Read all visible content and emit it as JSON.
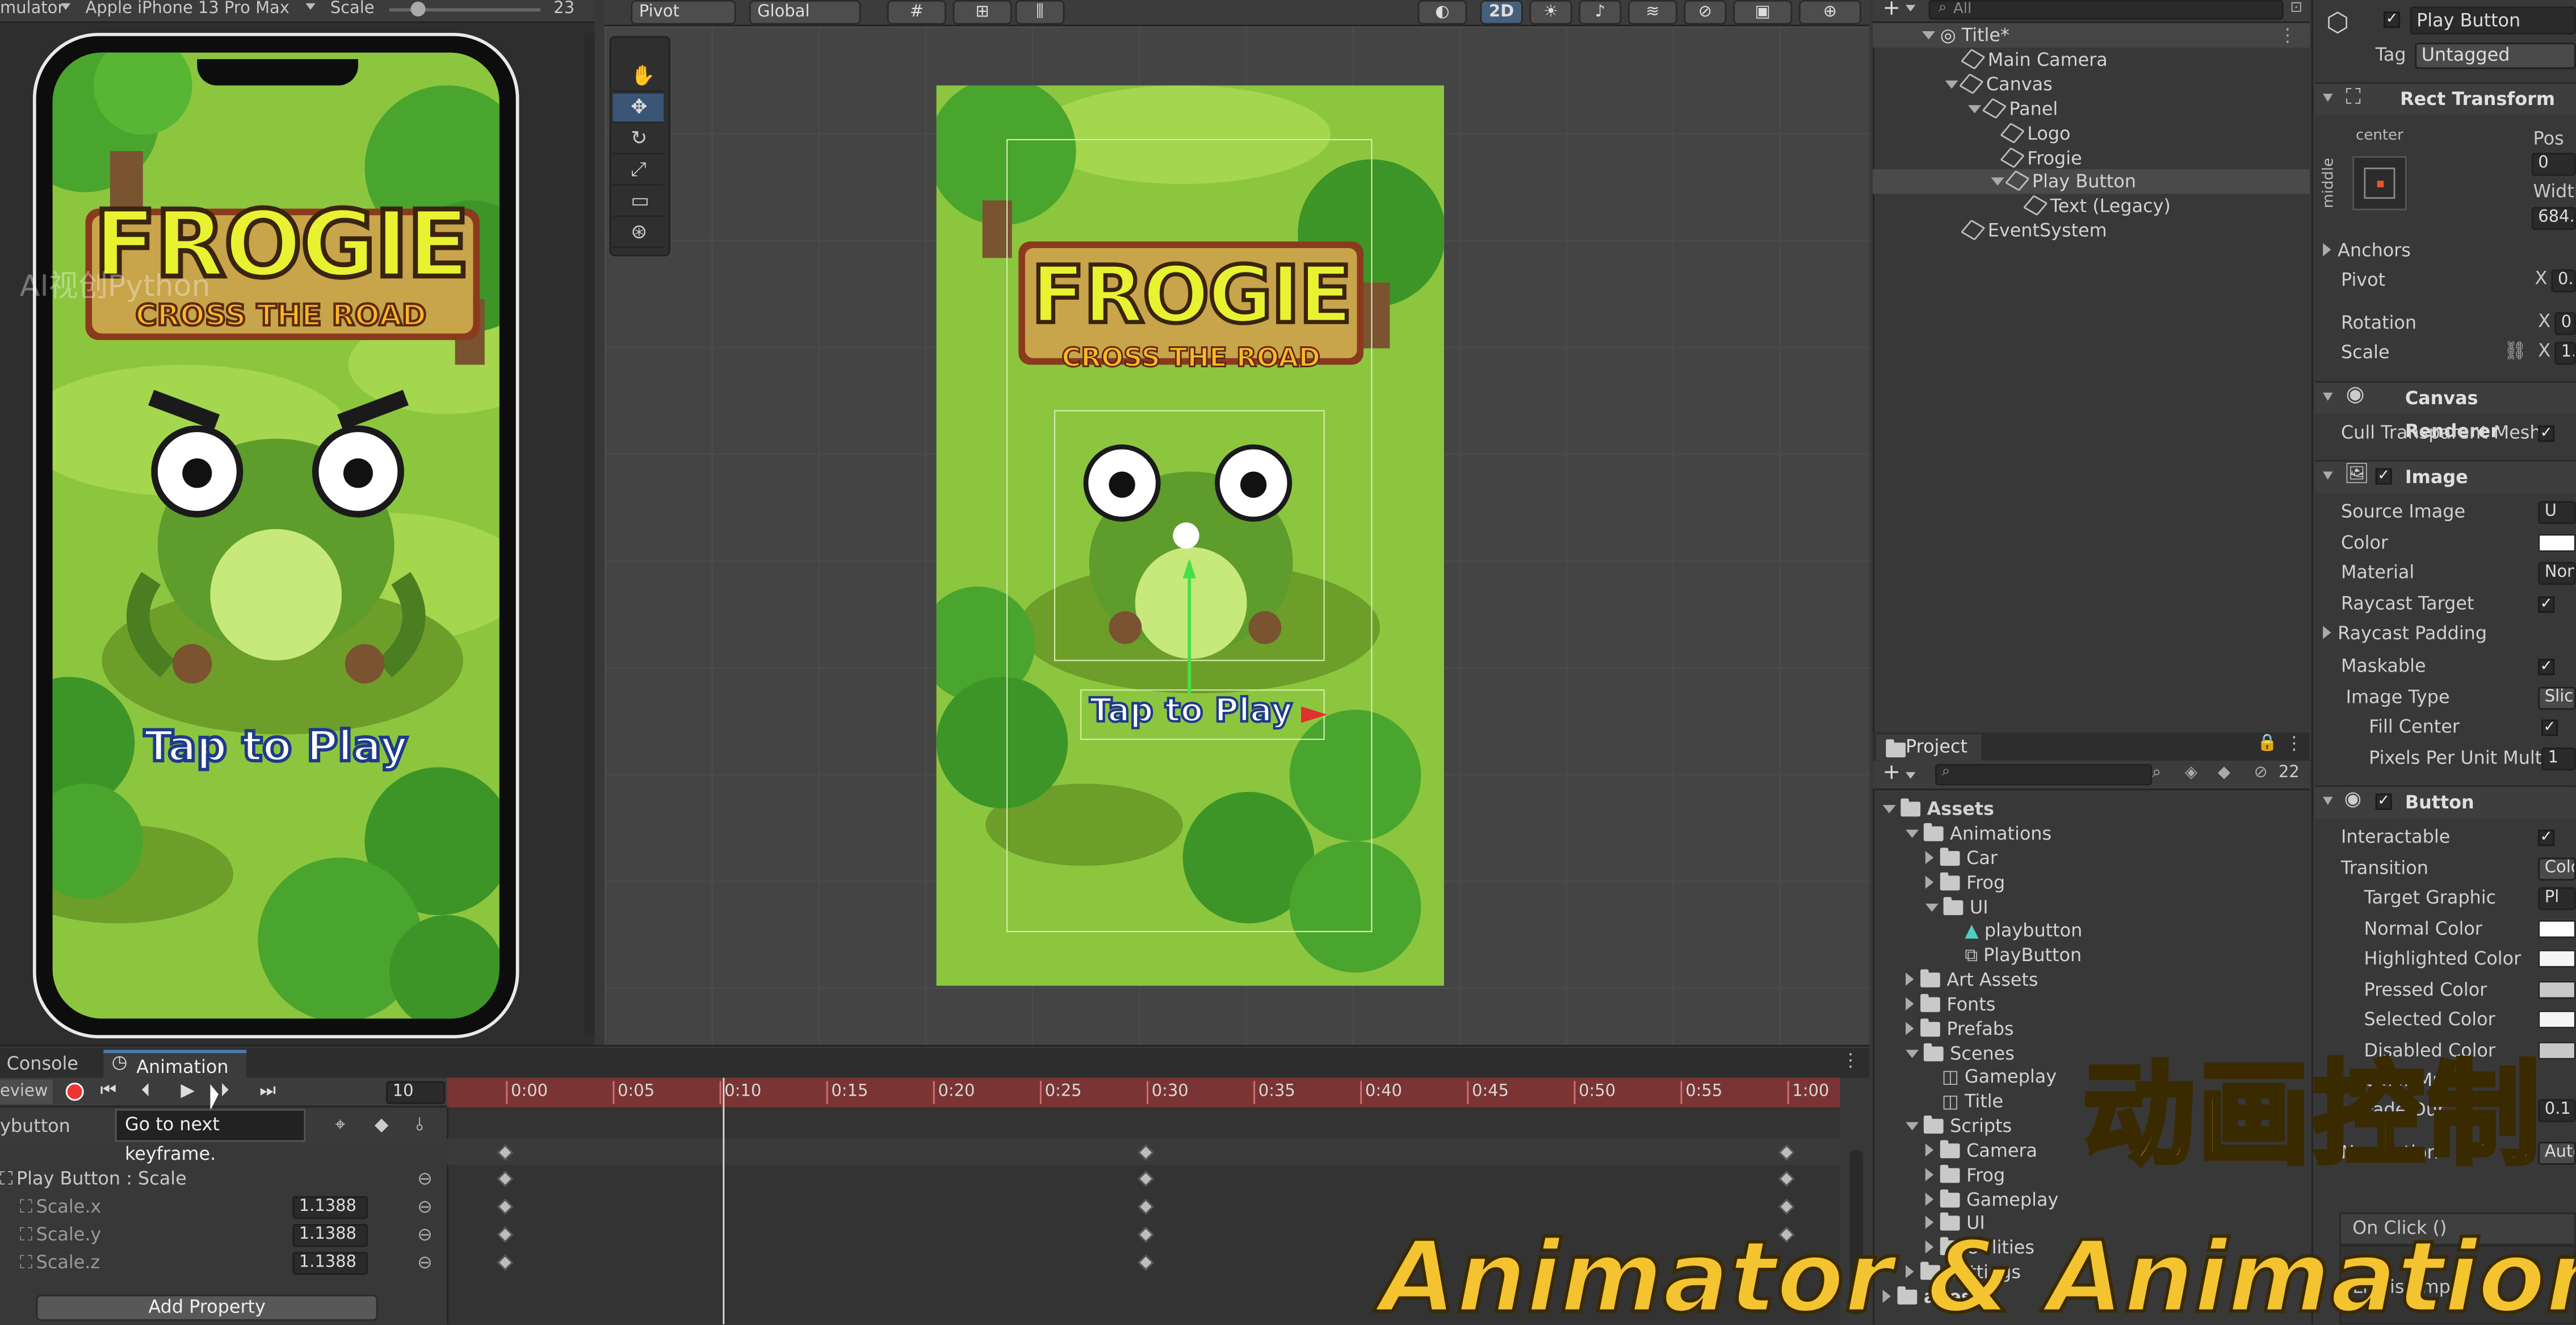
{
  "toolbar": {
    "simulator_label": "mulator",
    "device_label": "Apple iPhone 13 Pro Max",
    "scale_label": "Scale",
    "scale_value": "23",
    "pivot_label": "Pivot",
    "global_label": "Global",
    "mode_2d_label": "2D"
  },
  "game": {
    "title_line1": "FROGIE",
    "title_line2": "CROSS THE ROAD",
    "tap_to_play": "Tap to Play",
    "watermark": "AI视创Python"
  },
  "hierarchy": {
    "search_placeholder": "All",
    "items": [
      {
        "label": "Title*"
      },
      {
        "label": "Main Camera"
      },
      {
        "label": "Canvas"
      },
      {
        "label": "Panel"
      },
      {
        "label": "Logo"
      },
      {
        "label": "Frogie"
      },
      {
        "label": "Play Button"
      },
      {
        "label": "Text (Legacy)"
      },
      {
        "label": "EventSystem"
      }
    ]
  },
  "project": {
    "tab_label": "Project",
    "count_badge": "22",
    "tree": [
      {
        "label": "Assets"
      },
      {
        "label": "Animations"
      },
      {
        "label": "Car"
      },
      {
        "label": "Frog"
      },
      {
        "label": "UI"
      },
      {
        "label": "playbutton"
      },
      {
        "label": "PlayButton"
      },
      {
        "label": "Art Assets"
      },
      {
        "label": "Fonts"
      },
      {
        "label": "Prefabs"
      },
      {
        "label": "Scenes"
      },
      {
        "label": "Gameplay"
      },
      {
        "label": "Title"
      },
      {
        "label": "Scripts"
      },
      {
        "label": "Camera"
      },
      {
        "label": "Frog"
      },
      {
        "label": "Gameplay"
      },
      {
        "label": "UI"
      },
      {
        "label": "Utilities"
      },
      {
        "label": "Settings"
      },
      {
        "label": "ages"
      }
    ]
  },
  "inspector": {
    "object_name": "Play Button",
    "tag_label": "Tag",
    "tag_value": "Untagged",
    "rect_transform": "Rect Transform",
    "anchor_h": "center",
    "anchor_v": "middle",
    "pos_label": "Pos X",
    "pos_value": "0",
    "width_label": "Width",
    "width_value": "684.",
    "anchors": "Anchors",
    "pivot": "Pivot",
    "pivot_x": "0.5",
    "rotation": "Rotation",
    "rotation_x": "0",
    "scale": "Scale",
    "scale_x": "1.",
    "canvas_renderer": "Canvas Renderer",
    "cull_transparent": "Cull Transparent Mesh",
    "image": "Image",
    "source_image": "Source Image",
    "source_image_value": "U",
    "color": "Color",
    "material": "Material",
    "material_value": "Non",
    "raycast_target": "Raycast Target",
    "raycast_padding": "Raycast Padding",
    "maskable": "Maskable",
    "image_type": "Image Type",
    "image_type_value": "Slic",
    "fill_center": "Fill Center",
    "ppu_multiplier": "Pixels Per Unit Multi",
    "ppu_value": "1",
    "button": "Button",
    "interactable": "Interactable",
    "transition": "Transition",
    "transition_value": "Colo",
    "target_graphic": "Target Graphic",
    "target_graphic_value": "Pl",
    "normal_color": "Normal Color",
    "highlighted_color": "Highlighted Color",
    "pressed_color": "Pressed Color",
    "selected_color": "Selected Color",
    "disabled_color": "Disabled Color",
    "color_multiplier": "Color Multipl",
    "fade_duration": "Fade Dur",
    "fade_value": "0.1",
    "navigation": "Navigation",
    "navigation_value": "Auto",
    "on_click": "On Click ()",
    "list_empty": "List is Emp"
  },
  "animation": {
    "tab_console": "Console",
    "tab_animation": "Animation",
    "preview_label": "eview",
    "frame_value": "10",
    "clip_label": "ybutton",
    "tooltip": "Go to next keyframe.",
    "time_ticks": [
      "0:00",
      "0:05",
      "0:10",
      "0:15",
      "0:20",
      "0:25",
      "0:30",
      "0:35",
      "0:40",
      "0:45",
      "0:50",
      "0:55",
      "1:00"
    ],
    "property_group": "Play Button : Scale",
    "properties": [
      {
        "name": "Scale.x",
        "value": "1.1388"
      },
      {
        "name": "Scale.y",
        "value": "1.1388"
      },
      {
        "name": "Scale.z",
        "value": "1.1388"
      }
    ],
    "add_property": "Add Property"
  },
  "overlay": {
    "chinese_title": "动画控制",
    "english_title": "Animator & Animation"
  },
  "colors": {
    "panel_bg": "#383838",
    "timeline_red": "#7a3434",
    "accent_blue": "#3a5575",
    "overlay_yellow": "#f4c430",
    "game_green": "#8cc63f"
  }
}
